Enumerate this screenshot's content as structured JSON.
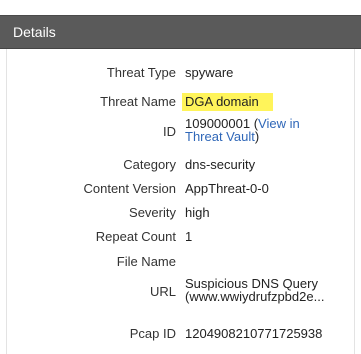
{
  "header": {
    "title": "Details"
  },
  "fields": {
    "threat_type": {
      "label": "Threat Type",
      "value": "spyware"
    },
    "threat_name": {
      "label": "Threat Name",
      "value": "DGA domain"
    },
    "id": {
      "label": "ID",
      "value": "109000001 ",
      "link_open": "(",
      "link_line1": "View in",
      "link_line2": "Threat Vault",
      "link_close": ")"
    },
    "category": {
      "label": "Category",
      "value": "dns-security"
    },
    "content_version": {
      "label": "Content Version",
      "value": "AppThreat-0-0"
    },
    "severity": {
      "label": "Severity",
      "value": "high"
    },
    "repeat_count": {
      "label": "Repeat Count",
      "value": "1"
    },
    "file_name": {
      "label": "File Name",
      "value": ""
    },
    "url": {
      "label": "URL",
      "line1": "Suspicious DNS Query",
      "line2": "(www.wwiydrufzpbd2e..."
    },
    "pcap_id": {
      "label": "Pcap ID",
      "value": "1204908210771725938"
    }
  },
  "colors": {
    "header_bg": "#5a5a5a",
    "highlight": "#fff45a",
    "link": "#2f67b8"
  }
}
